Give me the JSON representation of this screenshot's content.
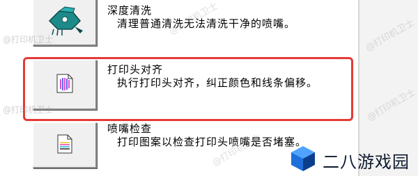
{
  "tools": [
    {
      "title": "深度清洗",
      "description": "清理普通清洗无法清洗干净的喷嘴。",
      "icon": "deep-clean-icon"
    },
    {
      "title": "打印头对齐",
      "description": "执行打印头对齐，纠正颜色和线条偏移。",
      "icon": "head-alignment-icon"
    },
    {
      "title": "喷嘴检查",
      "description": "打印图案以检查打印头喷嘴是否堵塞。",
      "icon": "nozzle-check-icon"
    }
  ],
  "watermark": "@打印机卫士",
  "brand": {
    "name": "二八游戏园"
  },
  "colors": {
    "highlight": "#e53935",
    "accent_teal": "#1d8a8a",
    "logo_blue": "#1e6fd9"
  }
}
